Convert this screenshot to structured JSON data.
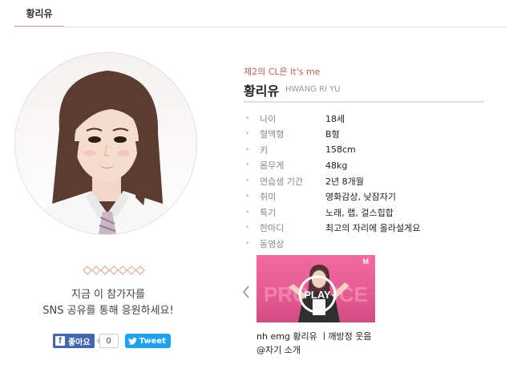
{
  "tab": {
    "label": "황리유"
  },
  "profile": {
    "tagline": "제2의 CL은 It's me",
    "name": "황리유",
    "name_en": "HWANG RI YU",
    "info": [
      {
        "label": "나이",
        "value": "18세"
      },
      {
        "label": "혈액형",
        "value": "B형"
      },
      {
        "label": "키",
        "value": "158cm"
      },
      {
        "label": "몸무게",
        "value": "48kg"
      },
      {
        "label": "연습생 기간",
        "value": "2년 8개월"
      },
      {
        "label": "취미",
        "value": "영화감상, 낮잠자기"
      },
      {
        "label": "특기",
        "value": "노래, 랩, 걸스힙합"
      },
      {
        "label": "한마디",
        "value": "최고의 자리에 올라설게요"
      },
      {
        "label": "동영상",
        "value": ""
      }
    ]
  },
  "support": {
    "line1": "지금 이 참가자를",
    "line2": "SNS 공유를 통해 응원하세요!"
  },
  "share": {
    "like_label": "좋아요",
    "like_count": "0",
    "tweet_label": "Tweet"
  },
  "video": {
    "play_label": "PLAY",
    "brand": "M",
    "thumb_text": "PRODUCE",
    "caption_line1": "nh emg 황리유 ㅣ깨방정 웃음",
    "caption_line2": "@자기 소개"
  },
  "colors": {
    "accent_red": "#d9534f",
    "tab_underline": "#d9a08b",
    "facebook": "#4267b2",
    "twitter": "#1da1f2",
    "video_pink": "#e45b91"
  }
}
